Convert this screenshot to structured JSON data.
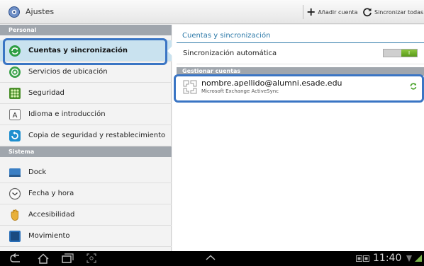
{
  "actionbar": {
    "title": "Ajustes",
    "add_account": "Añadir cuenta",
    "sync_all": "Sincronizar todas"
  },
  "sidebar": {
    "section_personal": "Personal",
    "section_system": "Sistema",
    "items": [
      {
        "label": "Cuentas y sincronización",
        "icon": "sync-icon",
        "selected": true
      },
      {
        "label": "Servicios de ubicación",
        "icon": "location-icon"
      },
      {
        "label": "Seguridad",
        "icon": "security-icon"
      },
      {
        "label": "Idioma e introducción",
        "icon": "language-icon"
      },
      {
        "label": "Copia de seguridad y restablecimiento",
        "icon": "backup-icon"
      },
      {
        "label": "Dock",
        "icon": "dock-icon"
      },
      {
        "label": "Fecha y hora",
        "icon": "clock-icon"
      },
      {
        "label": "Accesibilidad",
        "icon": "accessibility-icon"
      },
      {
        "label": "Movimiento",
        "icon": "motion-icon"
      }
    ]
  },
  "content": {
    "header": "Cuentas y sincronización",
    "auto_sync_label": "Sincronización automática",
    "auto_sync_on": true,
    "toggle_text": "I",
    "manage_header": "Gestionar cuentas",
    "account": {
      "email": "nombre.apellido@alumni.esade.edu",
      "type": "Microsoft Exchange ActiveSync"
    }
  },
  "statusbar": {
    "time": "11:40"
  },
  "colors": {
    "accent": "#2c79a8",
    "highlight": "#3a75c4",
    "section": "#a0a6ad",
    "selected": "#c9e2ef"
  }
}
